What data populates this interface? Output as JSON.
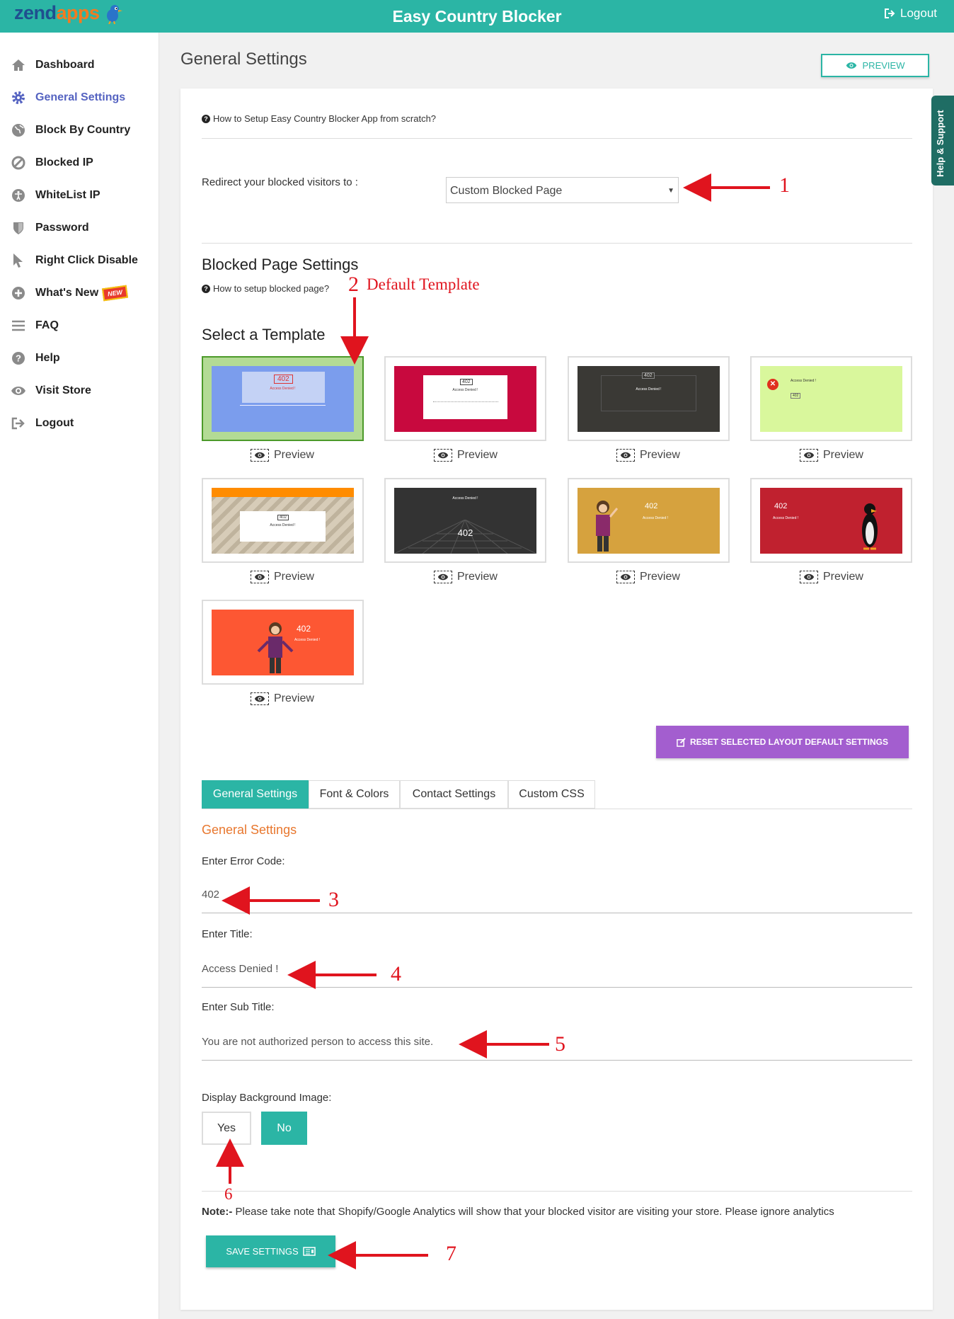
{
  "header": {
    "logo_zend": "zend",
    "logo_apps": "apps",
    "title": "Easy Country Blocker",
    "logout": "Logout"
  },
  "sidebar": {
    "items": [
      {
        "label": "Dashboard",
        "icon": "home-icon"
      },
      {
        "label": "General Settings",
        "icon": "gear-icon",
        "active": true
      },
      {
        "label": "Block By Country",
        "icon": "globe-icon"
      },
      {
        "label": "Blocked IP",
        "icon": "ban-icon"
      },
      {
        "label": "WhiteList IP",
        "icon": "accessibility-icon"
      },
      {
        "label": "Password",
        "icon": "shield-icon"
      },
      {
        "label": "Right Click Disable",
        "icon": "cursor-icon"
      },
      {
        "label": "What's New",
        "icon": "plus-circle-icon",
        "badge": "NEW"
      },
      {
        "label": "FAQ",
        "icon": "bars-icon"
      },
      {
        "label": "Help",
        "icon": "question-circle-icon"
      },
      {
        "label": "Visit Store",
        "icon": "eye-icon"
      },
      {
        "label": "Logout",
        "icon": "sign-out-icon"
      }
    ]
  },
  "page": {
    "title": "General Settings",
    "preview_button": "PREVIEW",
    "help_tab": "Help & Support"
  },
  "setup": {
    "howto": "How to Setup Easy Country Blocker App from scratch?"
  },
  "redirect": {
    "label": "Redirect your blocked visitors to :",
    "value": "Custom Blocked Page"
  },
  "blocked_page": {
    "heading": "Blocked Page Settings",
    "howto": "How to setup blocked page?"
  },
  "templates": {
    "heading": "Select a Template",
    "preview_label": "Preview",
    "items": [
      {
        "id": 1,
        "code": "402",
        "title": "Access Denied !",
        "bg": "#7b9ded",
        "selected": true
      },
      {
        "id": 2,
        "code": "402",
        "title": "Access Denied !",
        "bg": "#c8093e"
      },
      {
        "id": 3,
        "code": "402",
        "title": "Access Denied !",
        "bg": "#3a3935"
      },
      {
        "id": 4,
        "code": "402",
        "title": "Access Denied !",
        "bg": "#d9f79c"
      },
      {
        "id": 5,
        "code": "402",
        "title": "Access Denied !",
        "bg": "#d7ccb8"
      },
      {
        "id": 6,
        "code": "402",
        "title": "Access Denied !",
        "bg": "#333333"
      },
      {
        "id": 7,
        "code": "402",
        "title": "Access Denied !",
        "bg": "#d6a23e"
      },
      {
        "id": 8,
        "code": "402",
        "title": "Access Denied !",
        "bg": "#c0212f"
      },
      {
        "id": 9,
        "code": "402",
        "title": "Access Denied !",
        "bg": "#fd5733"
      }
    ]
  },
  "reset_button": "RESET SELECTED LAYOUT DEFAULT SETTINGS",
  "tabs": [
    {
      "label": "General Settings",
      "active": true
    },
    {
      "label": "Font & Colors"
    },
    {
      "label": "Contact Settings"
    },
    {
      "label": "Custom CSS"
    }
  ],
  "general": {
    "section_title": "General Settings",
    "error_code_label": "Enter Error Code:",
    "error_code": "402",
    "title_label": "Enter Title:",
    "title_value": "Access Denied !",
    "subtitle_label": "Enter Sub Title:",
    "subtitle_value": "You are not authorized person to access this site.",
    "bg_label": "Display Background Image:",
    "yes": "Yes",
    "no": "No",
    "note_prefix": "Note:-",
    "note": "Please take note that Shopify/Google Analytics will show that your blocked visitor are visiting your store. Please ignore analytics",
    "save": "SAVE SETTINGS"
  },
  "annotations": {
    "n1": "1",
    "n2": "2",
    "default_template": "Default Template",
    "n3": "3",
    "n4": "4",
    "n5": "5",
    "n6": "6",
    "n7": "7"
  },
  "colors": {
    "teal": "#2bb5a5",
    "purple": "#a35ecf",
    "active_nav": "#5563c1",
    "orange_title": "#e8772e",
    "annotation": "#e0141e"
  }
}
